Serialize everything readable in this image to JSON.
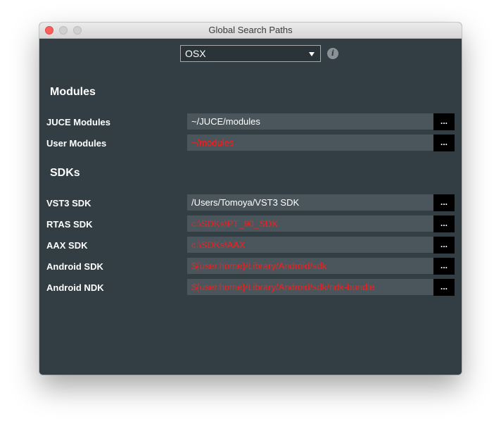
{
  "window": {
    "title": "Global Search Paths"
  },
  "os_selector": {
    "value": "OSX"
  },
  "colors": {
    "background": "#323e44",
    "field": "#4b565c",
    "invalid_path": "#ff1a1a"
  },
  "modules": {
    "heading": "Modules",
    "rows": [
      {
        "label": "JUCE Modules",
        "value": "~/JUCE/modules",
        "valid": true,
        "button": "..."
      },
      {
        "label": "User Modules",
        "value": "~/modules",
        "valid": false,
        "button": "..."
      }
    ]
  },
  "sdks": {
    "heading": "SDKs",
    "rows": [
      {
        "label": "VST3 SDK",
        "value": "/Users/Tomoya/VST3 SDK",
        "valid": true,
        "button": "..."
      },
      {
        "label": "RTAS SDK",
        "value": "c:\\SDKs\\PT_90_SDK",
        "valid": false,
        "button": "..."
      },
      {
        "label": "AAX SDK",
        "value": "c:\\SDKs\\AAX",
        "valid": false,
        "button": "..."
      },
      {
        "label": "Android SDK",
        "value": "${user.home}/Library/Android/sdk",
        "valid": false,
        "button": "..."
      },
      {
        "label": "Android NDK",
        "value": "${user.home}/Library/Android/sdk/ndk-bundle",
        "valid": false,
        "button": "..."
      }
    ]
  }
}
